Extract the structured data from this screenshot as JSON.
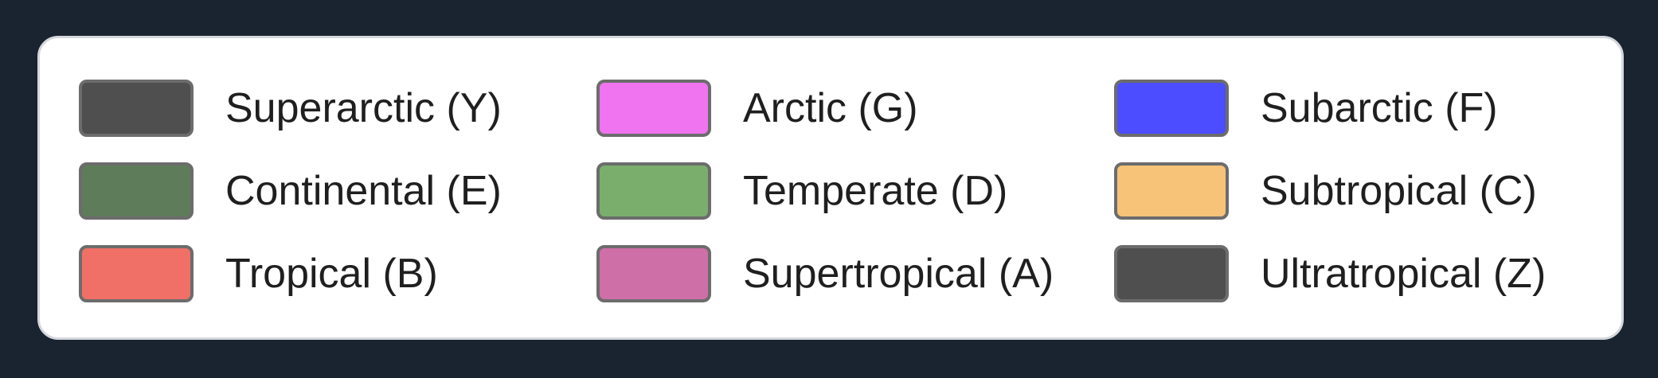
{
  "legend": {
    "items": [
      {
        "label": "Superarctic (Y)",
        "color": "#4f4f4f"
      },
      {
        "label": "Arctic (G)",
        "color": "#f074ef"
      },
      {
        "label": "Subarctic (F)",
        "color": "#4b4dff"
      },
      {
        "label": "Continental (E)",
        "color": "#5f7c5a"
      },
      {
        "label": "Temperate (D)",
        "color": "#7aae6c"
      },
      {
        "label": "Subtropical (C)",
        "color": "#f6c379"
      },
      {
        "label": "Tropical (B)",
        "color": "#f07068"
      },
      {
        "label": "Supertropical (A)",
        "color": "#cf6fa8"
      },
      {
        "label": "Ultratropical (Z)",
        "color": "#4f4f4f"
      }
    ]
  }
}
